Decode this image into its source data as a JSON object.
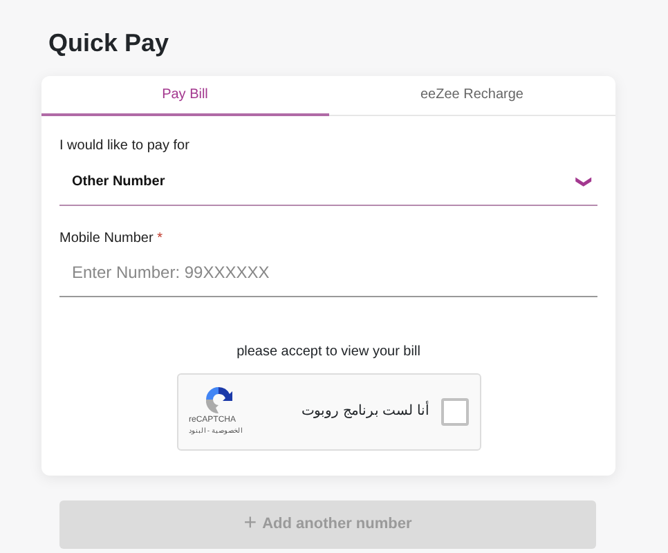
{
  "title": "Quick Pay",
  "tabs": [
    {
      "label": "Pay Bill",
      "selected": true
    },
    {
      "label": "eeZee Recharge",
      "selected": false
    }
  ],
  "pay_for": {
    "label": "I would like to pay for",
    "value": "Other Number",
    "caret": "❯"
  },
  "mobile_number": {
    "label": "Mobile Number",
    "required_mark": "*",
    "placeholder": "Enter Number: 99XXXXXX"
  },
  "captcha": {
    "prompt": "please accept to view your bill",
    "checkbox_label": "أنا لست برنامج روبوت",
    "checked": false,
    "brand": "reCAPTCHA",
    "links": "الخصوصية - البنود"
  },
  "add_button": {
    "icon": "+",
    "label": "Add another number",
    "disabled": true
  }
}
